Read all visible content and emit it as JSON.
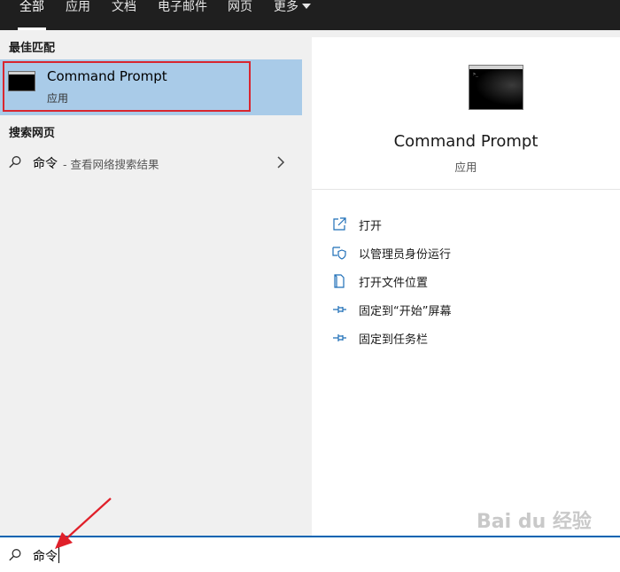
{
  "tabs": [
    {
      "label": "全部",
      "active": true
    },
    {
      "label": "应用"
    },
    {
      "label": "文档"
    },
    {
      "label": "电子邮件"
    },
    {
      "label": "网页"
    },
    {
      "label": "更多"
    }
  ],
  "left": {
    "best_match_heading": "最佳匹配",
    "best_match": {
      "title": "Command Prompt",
      "subtitle": "应用",
      "icon": "cmd-icon"
    },
    "web_heading": "搜索网页",
    "web_result": {
      "query": "命令",
      "suffix": " - 查看网络搜索结果",
      "icon": "search-icon"
    }
  },
  "right": {
    "title": "Command Prompt",
    "subtitle": "应用",
    "actions": [
      {
        "label": "打开",
        "icon": "open-icon"
      },
      {
        "label": "以管理员身份运行",
        "icon": "shield-icon"
      },
      {
        "label": "打开文件位置",
        "icon": "file-location-icon"
      },
      {
        "label": "固定到“开始”屏幕",
        "icon": "pin-icon"
      },
      {
        "label": "固定到任务栏",
        "icon": "pin-icon"
      }
    ]
  },
  "search": {
    "value": "命令"
  },
  "watermark": {
    "text": "Bai du 经验",
    "url": "jingyan.baidu.com"
  },
  "colors": {
    "accent": "#0063b1",
    "selection": "#a9cbe8",
    "highlight_box": "#d9262f",
    "arrow": "#e0202a"
  }
}
